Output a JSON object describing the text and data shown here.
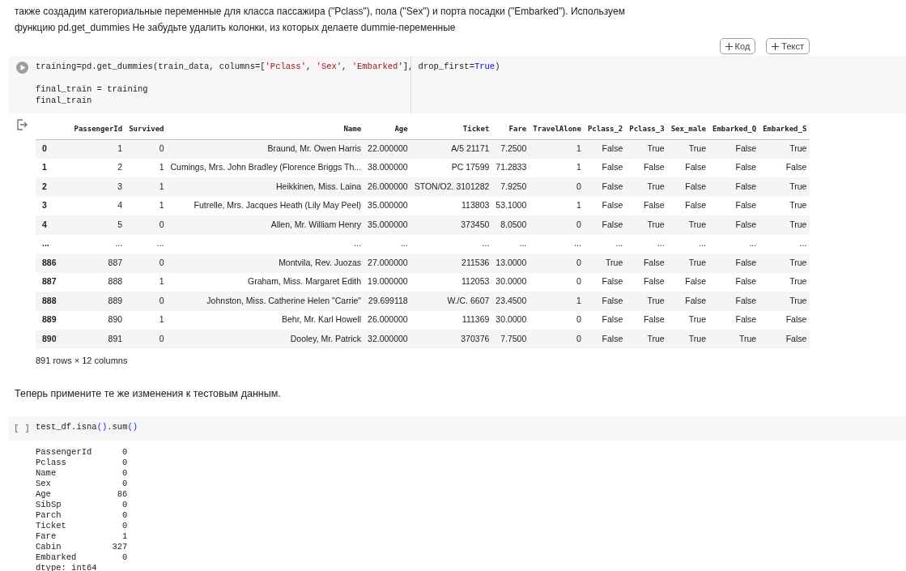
{
  "intro_text": "также создадим категориальные переменные для класса пассажира (\"Pclass\"), пола (\"Sex\") и порта посадки (\"Embarked\"). Используем функцию pd.get_dummies Не забудьте удалить колонки, из которых делаете dummie-переменные",
  "toolbar": {
    "buttons": [
      {
        "label": "Код"
      },
      {
        "label": "Текст"
      }
    ]
  },
  "cell_1": {
    "code_lines": [
      [
        {
          "kind": "plain",
          "text": "training=pd.get_dummies(train_data, columns=["
        },
        {
          "kind": "string",
          "text": "'Pclass'"
        },
        {
          "kind": "plain",
          "text": ", "
        },
        {
          "kind": "string",
          "text": "'Sex'"
        },
        {
          "kind": "plain",
          "text": ", "
        },
        {
          "kind": "string",
          "text": "'Embarked'"
        },
        {
          "kind": "plain",
          "text": "], drop_first="
        },
        {
          "kind": "keyword",
          "text": "True"
        },
        {
          "kind": "plain",
          "text": ")"
        }
      ],
      [
        {
          "kind": "blank_line"
        },
        {
          "kind": "plain",
          "text": "final_train = training"
        }
      ],
      [
        {
          "kind": "plain",
          "text": "final_train"
        }
      ]
    ],
    "output": {
      "columns": [
        "",
        "PassengerId",
        "Survived",
        "Name",
        "Age",
        "Ticket",
        "Fare",
        "TravelAlone",
        "Pclass_2",
        "Pclass_3",
        "Sex_male",
        "Embarked_Q",
        "Embarked_S"
      ],
      "rows": [
        [
          "0",
          "1",
          "0",
          "Braund, Mr. Owen Harris",
          "22.000000",
          "A/5 21171",
          "7.2500",
          "1",
          "False",
          "True",
          "True",
          "False",
          "True"
        ],
        [
          "1",
          "2",
          "1",
          "Cumings, Mrs. John Bradley (Florence Briggs Th...",
          "38.000000",
          "PC 17599",
          "71.2833",
          "1",
          "False",
          "False",
          "False",
          "False",
          "False"
        ],
        [
          "2",
          "3",
          "1",
          "Heikkinen, Miss. Laina",
          "26.000000",
          "STON/O2. 3101282",
          "7.9250",
          "0",
          "False",
          "True",
          "False",
          "False",
          "True"
        ],
        [
          "3",
          "4",
          "1",
          "Futrelle, Mrs. Jacques Heath (Lily May Peel)",
          "35.000000",
          "113803",
          "53.1000",
          "1",
          "False",
          "False",
          "False",
          "False",
          "True"
        ],
        [
          "4",
          "5",
          "0",
          "Allen, Mr. William Henry",
          "35.000000",
          "373450",
          "8.0500",
          "0",
          "False",
          "True",
          "True",
          "False",
          "True"
        ],
        [
          "...",
          "...",
          "...",
          "...",
          "...",
          "...",
          "...",
          "...",
          "...",
          "...",
          "...",
          "...",
          "..."
        ],
        [
          "886",
          "887",
          "0",
          "Montvila, Rev. Juozas",
          "27.000000",
          "211536",
          "13.0000",
          "0",
          "True",
          "False",
          "True",
          "False",
          "True"
        ],
        [
          "887",
          "888",
          "1",
          "Graham, Miss. Margaret Edith",
          "19.000000",
          "112053",
          "30.0000",
          "0",
          "False",
          "False",
          "False",
          "False",
          "True"
        ],
        [
          "888",
          "889",
          "0",
          "Johnston, Miss. Catherine Helen \"Carrie\"",
          "29.699118",
          "W./C. 6607",
          "23.4500",
          "1",
          "False",
          "True",
          "False",
          "False",
          "True"
        ],
        [
          "889",
          "890",
          "1",
          "Behr, Mr. Karl Howell",
          "26.000000",
          "111369",
          "30.0000",
          "0",
          "False",
          "False",
          "True",
          "False",
          "False"
        ],
        [
          "890",
          "891",
          "0",
          "Dooley, Mr. Patrick",
          "32.000000",
          "370376",
          "7.7500",
          "0",
          "False",
          "True",
          "True",
          "True",
          "False"
        ]
      ],
      "shape_caption": "891 rows × 12 columns"
    }
  },
  "text_2": "Теперь примените те же изменения к тестовым данным.",
  "cell_2": {
    "run_label": "[ ]",
    "code_lines": [
      [
        {
          "kind": "plain",
          "text": "test_df.isna"
        },
        {
          "kind": "paren",
          "text": "()"
        },
        {
          "kind": "plain",
          "text": ".sum"
        },
        {
          "kind": "paren",
          "text": "()"
        }
      ]
    ],
    "output_lines": [
      "PassengerId      0",
      "Pclass           0",
      "Name             0",
      "Sex              0",
      "Age             86",
      "SibSp            0",
      "Parch            0",
      "Ticket           0",
      "Fare             1",
      "Cabin          327",
      "Embarked         0",
      "dtype: int64"
    ]
  }
}
